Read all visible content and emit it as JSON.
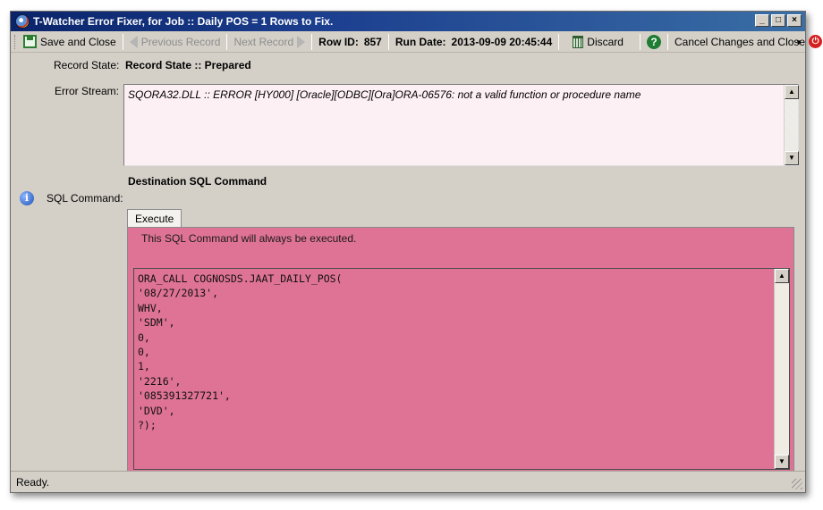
{
  "window": {
    "title": "T-Watcher Error Fixer, for Job :: Daily POS = 1 Rows to Fix.",
    "controls": [
      "_",
      "□",
      "×"
    ]
  },
  "toolbar": {
    "save_and_close": "Save and Close",
    "previous_record": "Previous Record",
    "next_record": "Next Record",
    "row_id_label": "Row ID:",
    "row_id_value": "857",
    "run_date_label": "Run Date:",
    "run_date_value": "2013-09-09 20:45:44",
    "discard": "Discard",
    "help_glyph": "?",
    "cancel_changes": "Cancel Changes and Close",
    "power_glyph": "⏻",
    "overflow_glyph": "▼"
  },
  "form": {
    "record_state_label": "Record State:",
    "record_state_value": "Record State :: Prepared",
    "error_stream_label": "Error Stream:",
    "error_stream_text": "SQORA32.DLL :: ERROR [HY000] [Oracle][ODBC][Ora]ORA-06576: not a valid function or procedure name",
    "destination_title": "Destination SQL Command",
    "sql_command_label": "SQL Command:",
    "info_glyph": "i",
    "tab_label": "Execute",
    "panel_note": "This SQL Command will always be executed.",
    "sql_text": "ORA_CALL COGNOSDS.JAAT_DAILY_POS(\n'08/27/2013',\nWHV,\n'SDM',\n0,\n0,\n1,\n'2216',\n'085391327721',\n'DVD',\n?);"
  },
  "scroll": {
    "up": "▲",
    "down": "▼"
  },
  "status": {
    "text": "Ready."
  },
  "colors": {
    "panel_pink": "#df7396",
    "error_bg": "#fdf0f4",
    "title_blue": "#0a246a"
  }
}
